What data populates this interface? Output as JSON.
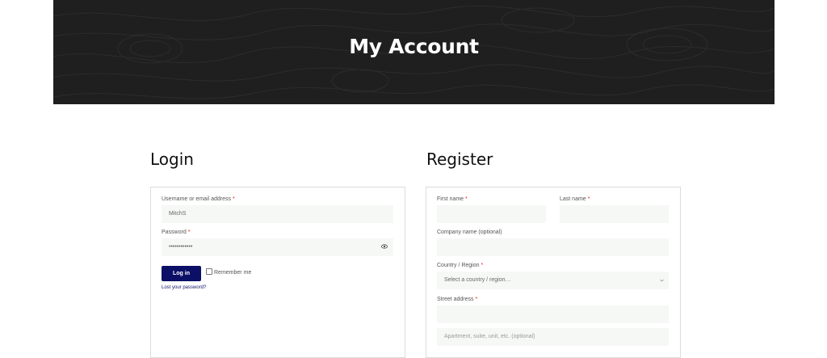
{
  "header": {
    "title": "My Account"
  },
  "login": {
    "title": "Login",
    "username_label": "Username or email address",
    "username_value": "MitchS",
    "password_label": "Password",
    "password_value": "••••••••••••",
    "required_mark": "*",
    "login_button": "Log in",
    "remember_label": "Remember me",
    "lost_password": "Lost your password?"
  },
  "register": {
    "title": "Register",
    "first_name_label": "First name",
    "last_name_label": "Last name",
    "company_label": "Company name (optional)",
    "country_label": "Country / Region",
    "country_value": "Select a country / region…",
    "street_label": "Street address",
    "street2_placeholder": "Apartment, suite, unit, etc. (optional)",
    "required_mark": "*"
  },
  "colors": {
    "hero_bg": "#1f1f1f",
    "button_bg": "#0b0f66",
    "required": "#e2231a",
    "field_bg": "#f6f8f6"
  },
  "icons": [
    "eye-icon",
    "chevron-down-icon",
    "checkbox-icon"
  ]
}
